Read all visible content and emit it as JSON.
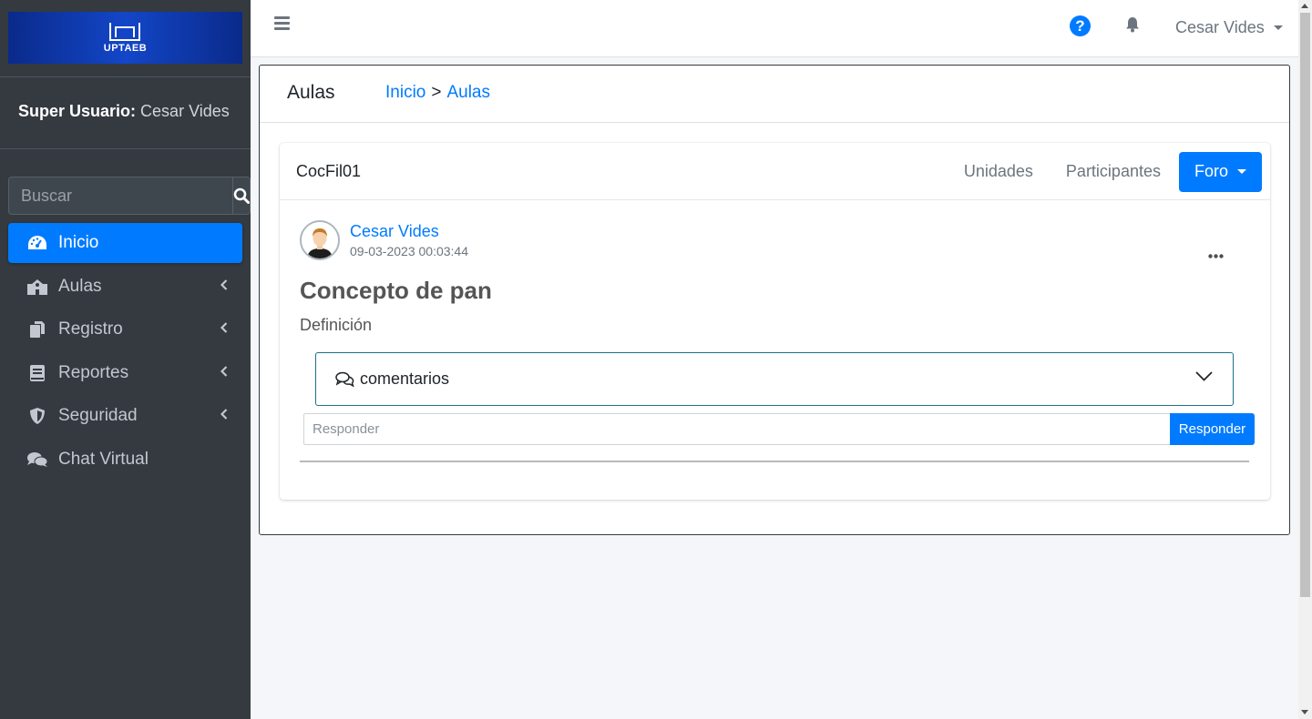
{
  "brand": {
    "logo_text": "UPTAEB"
  },
  "user_panel": {
    "role": "Super Usuario:",
    "name": "Cesar Vides"
  },
  "search": {
    "placeholder": "Buscar"
  },
  "nav": {
    "items": [
      {
        "label": "Inicio",
        "icon": "dashboard-icon",
        "active": true
      },
      {
        "label": "Aulas",
        "icon": "school-icon"
      },
      {
        "label": "Registro",
        "icon": "copy-icon"
      },
      {
        "label": "Reportes",
        "icon": "book-icon"
      },
      {
        "label": "Seguridad",
        "icon": "shield-icon"
      },
      {
        "label": "Chat Virtual",
        "icon": "comments-icon"
      }
    ]
  },
  "topbar": {
    "user": "Cesar Vides",
    "help_glyph": "?"
  },
  "page": {
    "title": "Aulas",
    "breadcrumb": {
      "home": "Inicio",
      "separator": ">",
      "current": "Aulas"
    }
  },
  "course": {
    "code": "CocFil01",
    "tabs": {
      "units": "Unidades",
      "participants": "Participantes",
      "forum": "Foro"
    }
  },
  "post": {
    "author": "Cesar Vides",
    "datetime": "09-03-2023 00:03:44",
    "title": "Concepto de pan",
    "body": "Definición",
    "comments_label": "comentarios",
    "reply_placeholder": "Responder",
    "reply_button": "Responder"
  },
  "colors": {
    "primary": "#007bff",
    "sidebar": "#343a40",
    "background": "#f4f6f9"
  }
}
